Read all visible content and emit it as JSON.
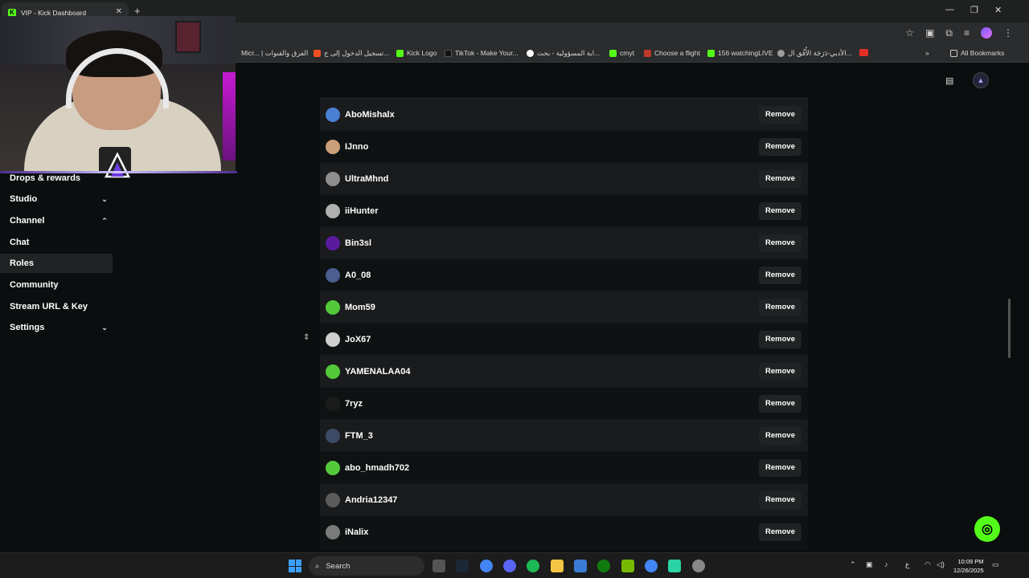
{
  "browser": {
    "tab_title": "VIP - Kick Dashboard",
    "tab_icon": "K",
    "bookmarks": [
      {
        "label": "Micr... | الفرق والقنوات",
        "color": "#6264a7"
      },
      {
        "label": "تسجيل الدخول إلى ج...",
        "color": "#f25022"
      },
      {
        "label": "Kick Logo",
        "color": "#53fc18"
      },
      {
        "label": "TikTok - Make Your...",
        "color": "#111111"
      },
      {
        "label": "ابة المسؤولية - بحث...",
        "color": "#4285f4"
      },
      {
        "label": "cmyt",
        "color": "#53fc18"
      },
      {
        "label": "Choose a flight",
        "color": "#c0392b"
      },
      {
        "label": "156 watchingLIVE",
        "color": "#53fc18"
      },
      {
        "label": "الأدبي-دَرَجَة الأُفُق ال...",
        "color": "#9e9e9e"
      }
    ],
    "all_bookmarks_label": "All Bookmarks"
  },
  "sidebar": {
    "items": [
      {
        "label": "Drops & rewards",
        "chevron": ""
      },
      {
        "label": "Studio",
        "chevron": "down"
      },
      {
        "label": "Channel",
        "chevron": "up"
      },
      {
        "label": "Chat",
        "chevron": ""
      },
      {
        "label": "Roles",
        "chevron": ""
      },
      {
        "label": "Community",
        "chevron": ""
      },
      {
        "label": "Stream URL & Key",
        "chevron": ""
      },
      {
        "label": "Settings",
        "chevron": "down"
      }
    ],
    "active_item": "Roles"
  },
  "vip_list": {
    "remove_label": "Remove",
    "users": [
      {
        "name": "AboMishalx",
        "avatar_color": "#4a7fd4"
      },
      {
        "name": "IJnno",
        "avatar_color": "#c9a07a"
      },
      {
        "name": "UltraMhnd",
        "avatar_color": "#8e8e8e"
      },
      {
        "name": "iiHunter",
        "avatar_color": "#b0b0b0"
      },
      {
        "name": "Bin3sl",
        "avatar_color": "#5a1a9e"
      },
      {
        "name": "A0_08",
        "avatar_color": "#4b5e8f"
      },
      {
        "name": "Mom59",
        "avatar_color": "#53c93a"
      },
      {
        "name": "JoX67",
        "avatar_color": "#cfcfcf"
      },
      {
        "name": "YAMENALAA04",
        "avatar_color": "#53c93a"
      },
      {
        "name": "7ryz",
        "avatar_color": "#1b1b1b"
      },
      {
        "name": "FTM_3",
        "avatar_color": "#3d4a66"
      },
      {
        "name": "abo_hmadh702",
        "avatar_color": "#53c93a"
      },
      {
        "name": "Andria12347",
        "avatar_color": "#5c5c5c"
      },
      {
        "name": "iNalix",
        "avatar_color": "#7a7a7a"
      }
    ]
  },
  "taskbar": {
    "search_label": "Search",
    "time": "10:09 PM",
    "date": "12/26/2025",
    "lang": "ع"
  },
  "colors": {
    "accent": "#53fc18",
    "background": "#0b0e0f",
    "row_alt": "#191b1c"
  }
}
